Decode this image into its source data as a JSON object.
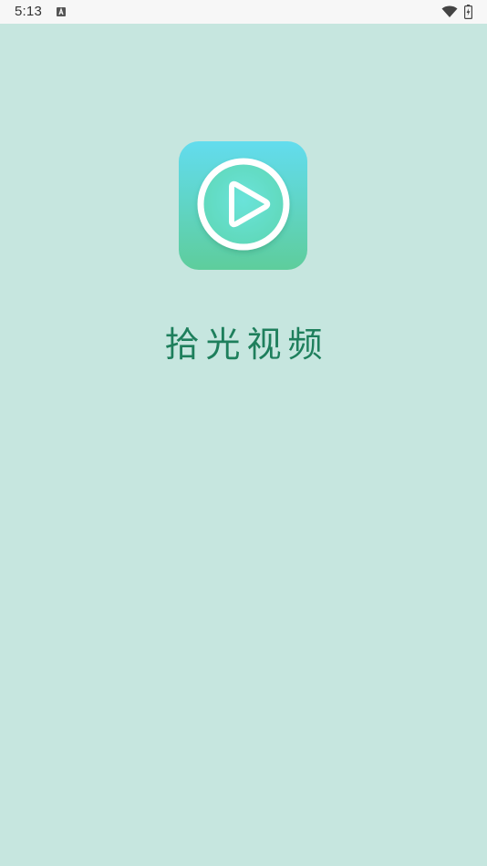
{
  "status_bar": {
    "time": "5:13",
    "notification_icon": "text-a-icon",
    "wifi_icon": "wifi-icon",
    "battery_icon": "battery-charging-icon"
  },
  "splash": {
    "logo_icon": "play-circle-icon",
    "app_name": "拾光视频"
  },
  "colors": {
    "background": "#c6e6df",
    "status_bar_bg": "#f7f7f7",
    "app_name_text": "#1e7f5c",
    "logo_gradient_top": "#62dcee",
    "logo_gradient_bottom": "#5ecd9c"
  }
}
